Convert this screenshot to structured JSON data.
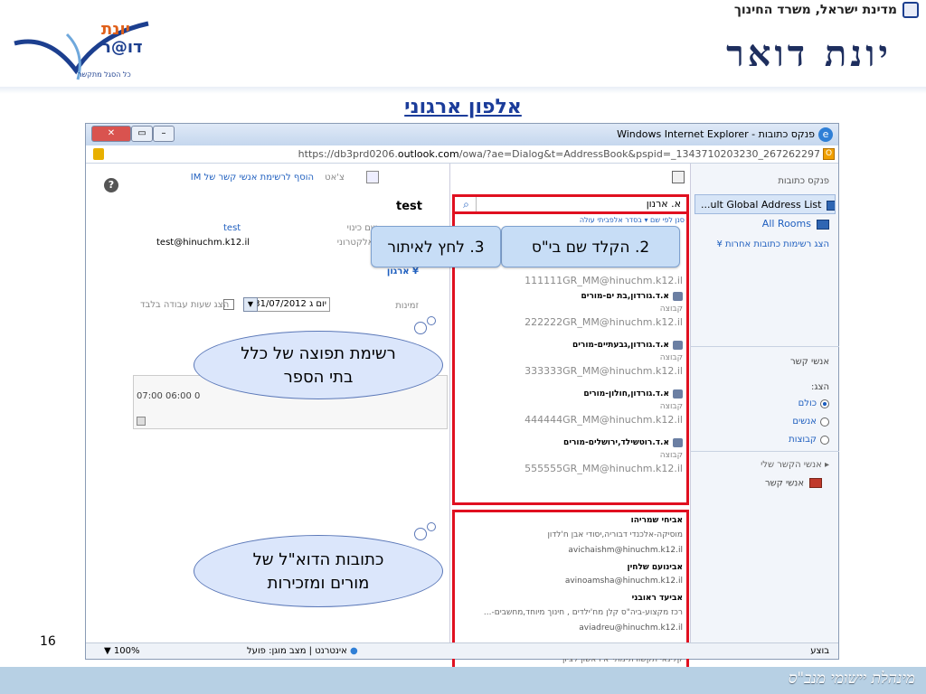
{
  "header": {
    "ministry": "מדינת ישראל, משרד החינוך",
    "brand_title": "יונת דואר",
    "logo_line1": "יונת",
    "logo_line2": "דו@ר",
    "logo_sub": "כל הסגל מתקשר"
  },
  "slide_title": "אלפון ארגוני",
  "browser": {
    "title": "פנקס כתובות - Windows Internet Explorer",
    "url_prefix": "https://db3prd0206.",
    "url_domain": "outlook.com",
    "url_rest": "/owa/?ae=Dialog&t=AddressBook&pspid=_1343710203230_267262297",
    "status_ready": "בוצע",
    "status_zone": "אינטרנט | מצב מוגן: פועל",
    "zoom": "100%"
  },
  "address_book": {
    "title": "פנקס כתובות",
    "selected_list": "...ult Global Address List",
    "all_rooms": "All Rooms",
    "other_lists": "הצג רשימות כתובות אחרות",
    "contacts_header": "אנשי קשר",
    "show_label": "הצג:",
    "radio_all": "כולם",
    "radio_people": "אנשים",
    "radio_groups": "קבוצות",
    "my_contacts": "אנשי הקשר שלי",
    "contacts_item": "אנשי קשר"
  },
  "search": {
    "value": "א. ארנון",
    "filter_text": "סנן לפי שם  ▾  בסדר אלפביתי עולה"
  },
  "results_groups": [
    {
      "name": "",
      "type": "",
      "email": "111111GR_MM@hinuchm.k12.il"
    },
    {
      "name": "א.ד.גורדון,בת ים-מורים",
      "type": "קבוצה",
      "email": "222222GR_MM@hinuchm.k12.il"
    },
    {
      "name": "א.ד.גורדון,גבעתיים-מורים",
      "type": "קבוצה",
      "email": "333333GR_MM@hinuchm.k12.il"
    },
    {
      "name": "א.ד.גורדון,חולון-מורים",
      "type": "קבוצה",
      "email": "444444GR_MM@hinuchm.k12.il"
    },
    {
      "name": "א.ד.רוטשילד,ירושלים-מורים",
      "type": "קבוצה",
      "email": "555555GR_MM@hinuchm.k12.il"
    }
  ],
  "results_people": [
    {
      "name": "אביחי שמריהו",
      "sub": "מוסיקה-אלכנדי דבוריה,יסודי אבן ח'לדון",
      "email": "avichaishm@hinuchm.k12.il"
    },
    {
      "name": "אבינועם שלחין",
      "sub": "",
      "email": "avinoamsha@hinuchm.k12.il"
    },
    {
      "name": "אביעד ראובני",
      "sub": "רכז מקצוע-ביה\"ס קלן מח'ילדים , חינוך מיוחד,מחשבים-...",
      "email": "aviadreu@hinuchm.k12.il"
    },
    {
      "name": "אבירם ששון",
      "sub": "קלינאי תקשורת-מתי\"א ראשון לציון",
      "email": ""
    }
  ],
  "details": {
    "name": "test",
    "add_link": "הוסף לרשימת אנשי קשר של IM",
    "chat_label": "צ'אט",
    "display_label": "שם כינוי",
    "display_value": "test",
    "email_label": "דואר אלקטרוני",
    "email_value": "test@hinuchm.k12.il",
    "org_link": "ארגון",
    "avail_label": "זמינות",
    "date_value": "31/07/2012",
    "day_value": "יום ג",
    "work_hours_label": "הצג שעות עבודה בלבד",
    "time_labels": "07:00  06:00  0"
  },
  "callouts": {
    "step2": "2. הקלד שם בי\"ס",
    "step3": "3. לחץ לאיתור",
    "cloud1": "רשימת תפוצה של כלל בתי הספר",
    "cloud2": "כתובות הדוא\"ל של מורים ומזכירות"
  },
  "page_number": "16",
  "footer_text": "מינהלת יישומי מנב\"ס"
}
